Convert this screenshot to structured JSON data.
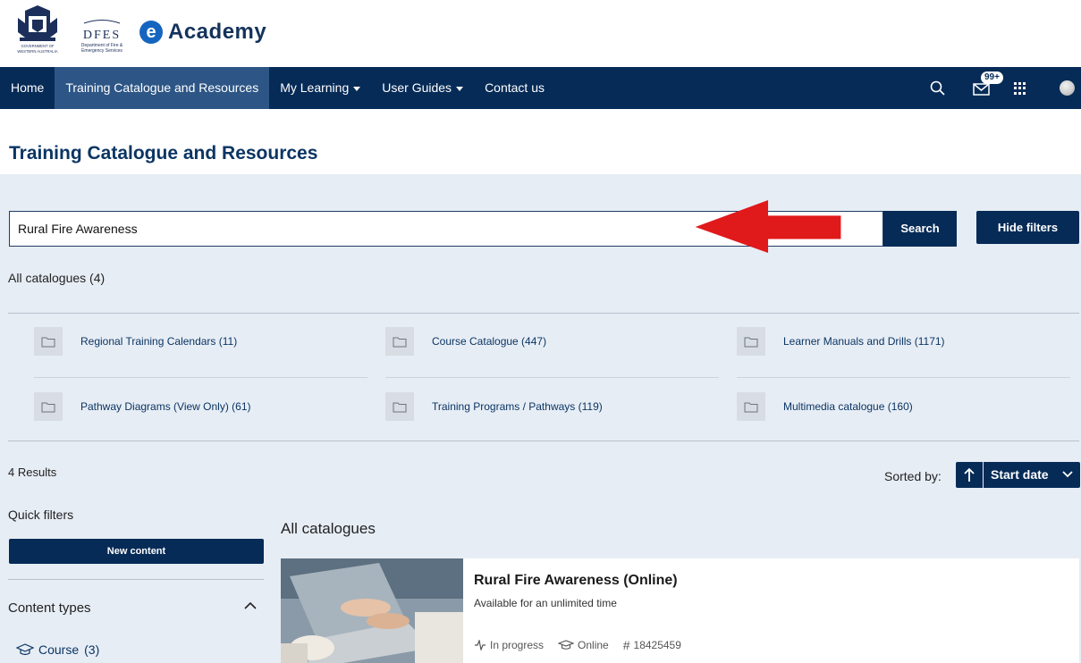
{
  "header": {
    "gov_name": "GOVERNMENT OF WESTERN AUSTRALIA",
    "dfes_word": "DFES",
    "dfes_sub": "Department of Fire & Emergency Services",
    "app_name": "Academy",
    "app_badge": "e"
  },
  "nav": {
    "items": [
      {
        "label": "Home"
      },
      {
        "label": "Training Catalogue and Resources"
      },
      {
        "label": "My Learning"
      },
      {
        "label": "User Guides"
      },
      {
        "label": "Contact us"
      }
    ],
    "mail_badge": "99+"
  },
  "page": {
    "title": "Training Catalogue and Resources"
  },
  "search": {
    "value": "Rural Fire Awareness",
    "button_label": "Search",
    "hide_filters_label": "Hide filters"
  },
  "catalogues": {
    "summary": "All catalogues (4)",
    "items": [
      {
        "label": "Regional Training Calendars (11)"
      },
      {
        "label": "Course Catalogue (447)"
      },
      {
        "label": "Learner Manuals and Drills (1171)"
      },
      {
        "label": "Pathway Diagrams (View Only) (61)"
      },
      {
        "label": "Training Programs / Pathways (119)"
      },
      {
        "label": "Multimedia catalogue (160)"
      }
    ]
  },
  "results": {
    "count_label": "4 Results",
    "sorted_by_label": "Sorted by:",
    "sort_value": "Start date"
  },
  "filters": {
    "quick_filters_label": "Quick filters",
    "new_content_label": "New content",
    "content_types_label": "Content types",
    "course_label": "Course",
    "course_count": "(3)"
  },
  "listing": {
    "heading": "All catalogues",
    "cards": [
      {
        "title": "Rural Fire Awareness (Online)",
        "availability": "Available for an unlimited time",
        "status": "In progress",
        "mode": "Online",
        "id": "18425459"
      }
    ]
  },
  "colors": {
    "navy": "#062b57",
    "nav_active": "#2d5686",
    "panel_bg": "#e7edf5",
    "title_blue": "#0b3563",
    "arrow_red": "#e0191b"
  }
}
